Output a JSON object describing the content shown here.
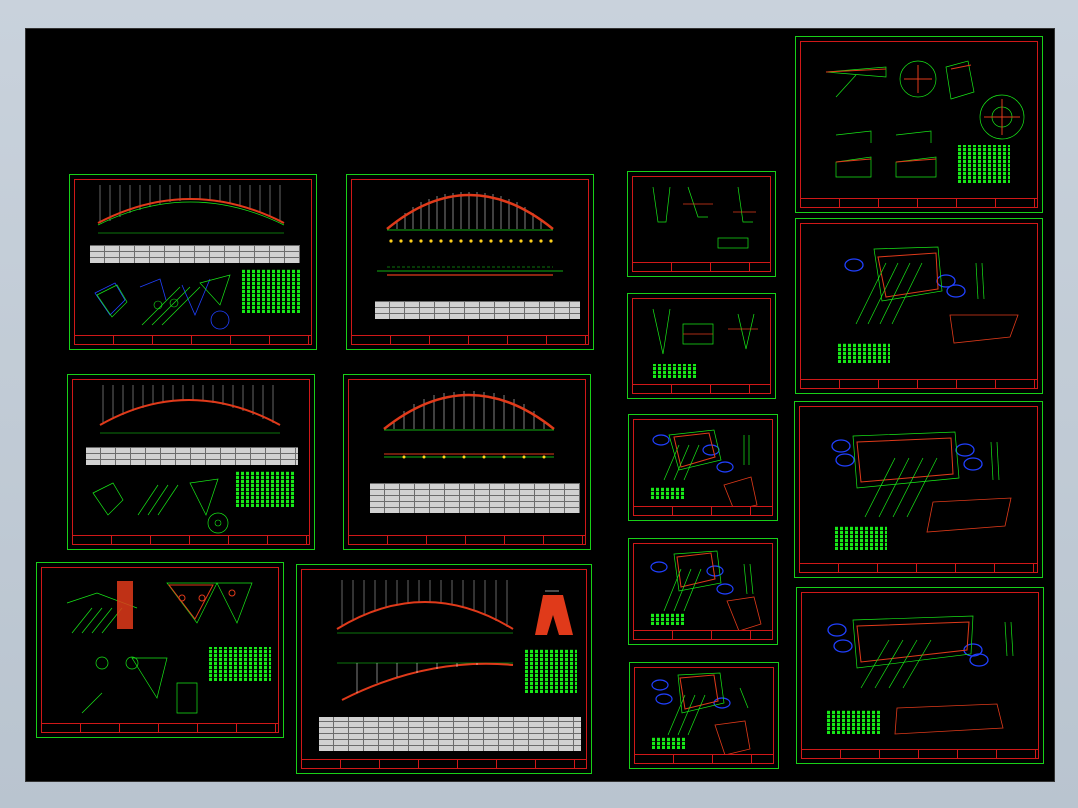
{
  "viewer": {
    "background_color": "#000000",
    "sheet_border_color": "#18d018",
    "frame_color": "#d01818",
    "arch_color": "#e03a1a",
    "line_color": "#18e818",
    "detail_color": "#2040ff",
    "title_text_color": "#ffd21e"
  },
  "sheets": [
    {
      "id": "s1",
      "kind": "arch-elevation-a"
    },
    {
      "id": "s2",
      "kind": "arch-hangers-a"
    },
    {
      "id": "s3",
      "kind": "arch-detail-c"
    },
    {
      "id": "s4",
      "kind": "arch-detail-d"
    },
    {
      "id": "s5",
      "kind": "arch-elevation-b"
    },
    {
      "id": "s6",
      "kind": "arch-hangers-b"
    },
    {
      "id": "s7",
      "kind": "node-detail"
    },
    {
      "id": "s8",
      "kind": "node-detail"
    },
    {
      "id": "s9",
      "kind": "joint-plate-a"
    },
    {
      "id": "s10",
      "kind": "joint-plate-b"
    },
    {
      "id": "s11",
      "kind": "node-details"
    },
    {
      "id": "s12",
      "kind": "arch-plan"
    },
    {
      "id": "s13",
      "kind": "joint-plate-c"
    },
    {
      "id": "s14",
      "kind": "joint-plate-d"
    },
    {
      "id": "s15",
      "kind": "joint-plate-e"
    },
    {
      "id": "s16",
      "kind": "joint-plate-f"
    },
    {
      "id": "s17",
      "kind": "joint-plate-g"
    }
  ]
}
